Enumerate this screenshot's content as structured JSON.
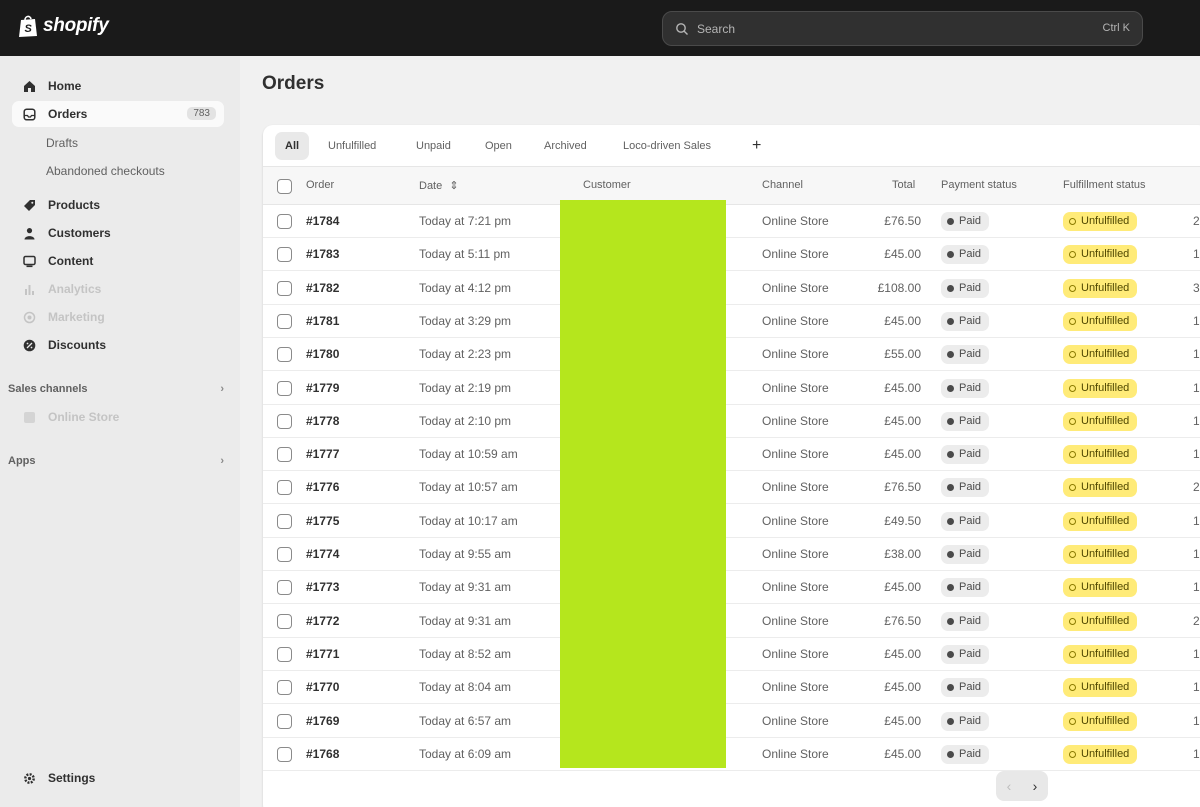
{
  "app": {
    "brand": "shopify"
  },
  "search": {
    "placeholder": "Search",
    "shortcut": "Ctrl K"
  },
  "sidebar": {
    "items": [
      {
        "label": "Home",
        "icon": "home-icon"
      },
      {
        "label": "Orders",
        "icon": "orders-icon",
        "badge": "783",
        "active": true
      },
      {
        "label": "Products",
        "icon": "tag-icon"
      },
      {
        "label": "Customers",
        "icon": "person-icon"
      },
      {
        "label": "Content",
        "icon": "content-icon"
      },
      {
        "label": "Analytics",
        "icon": "chart-icon",
        "disabled": true
      },
      {
        "label": "Marketing",
        "icon": "target-icon",
        "disabled": true
      },
      {
        "label": "Discounts",
        "icon": "discount-icon"
      }
    ],
    "order_subitems": [
      "Drafts",
      "Abandoned checkouts"
    ],
    "sales_channels": {
      "label": "Sales channels",
      "items": [
        "Online Store"
      ]
    },
    "apps": {
      "label": "Apps"
    },
    "settings": {
      "label": "Settings"
    }
  },
  "main": {
    "title": "Orders",
    "tabs": [
      "All",
      "Unfulfilled",
      "Unpaid",
      "Open",
      "Archived",
      "Loco-driven Sales"
    ],
    "add_tab": "+",
    "columns": [
      "Order",
      "Date",
      "Customer",
      "Channel",
      "Total",
      "Payment status",
      "Fulfillment status"
    ],
    "rows": [
      {
        "order": "#1784",
        "date": "Today at 7:21 pm",
        "channel": "Online Store",
        "total": "£76.50",
        "payment": "Paid",
        "fulfillment": "Unfulfilled",
        "items": "2"
      },
      {
        "order": "#1783",
        "date": "Today at 5:11 pm",
        "channel": "Online Store",
        "total": "£45.00",
        "payment": "Paid",
        "fulfillment": "Unfulfilled",
        "items": "1"
      },
      {
        "order": "#1782",
        "date": "Today at 4:12 pm",
        "channel": "Online Store",
        "total": "£108.00",
        "payment": "Paid",
        "fulfillment": "Unfulfilled",
        "items": "3"
      },
      {
        "order": "#1781",
        "date": "Today at 3:29 pm",
        "channel": "Online Store",
        "total": "£45.00",
        "payment": "Paid",
        "fulfillment": "Unfulfilled",
        "items": "1"
      },
      {
        "order": "#1780",
        "date": "Today at 2:23 pm",
        "channel": "Online Store",
        "total": "£55.00",
        "payment": "Paid",
        "fulfillment": "Unfulfilled",
        "items": "1"
      },
      {
        "order": "#1779",
        "date": "Today at 2:19 pm",
        "channel": "Online Store",
        "total": "£45.00",
        "payment": "Paid",
        "fulfillment": "Unfulfilled",
        "items": "1"
      },
      {
        "order": "#1778",
        "date": "Today at 2:10 pm",
        "channel": "Online Store",
        "total": "£45.00",
        "payment": "Paid",
        "fulfillment": "Unfulfilled",
        "items": "1"
      },
      {
        "order": "#1777",
        "date": "Today at 10:59 am",
        "channel": "Online Store",
        "total": "£45.00",
        "payment": "Paid",
        "fulfillment": "Unfulfilled",
        "items": "1"
      },
      {
        "order": "#1776",
        "date": "Today at 10:57 am",
        "channel": "Online Store",
        "total": "£76.50",
        "payment": "Paid",
        "fulfillment": "Unfulfilled",
        "items": "2"
      },
      {
        "order": "#1775",
        "date": "Today at 10:17 am",
        "channel": "Online Store",
        "total": "£49.50",
        "payment": "Paid",
        "fulfillment": "Unfulfilled",
        "items": "1"
      },
      {
        "order": "#1774",
        "date": "Today at 9:55 am",
        "channel": "Online Store",
        "total": "£38.00",
        "payment": "Paid",
        "fulfillment": "Unfulfilled",
        "items": "1"
      },
      {
        "order": "#1773",
        "date": "Today at 9:31 am",
        "channel": "Online Store",
        "total": "£45.00",
        "payment": "Paid",
        "fulfillment": "Unfulfilled",
        "items": "1"
      },
      {
        "order": "#1772",
        "date": "Today at 9:31 am",
        "channel": "Online Store",
        "total": "£76.50",
        "payment": "Paid",
        "fulfillment": "Unfulfilled",
        "items": "2"
      },
      {
        "order": "#1771",
        "date": "Today at 8:52 am",
        "channel": "Online Store",
        "total": "£45.00",
        "payment": "Paid",
        "fulfillment": "Unfulfilled",
        "items": "1"
      },
      {
        "order": "#1770",
        "date": "Today at 8:04 am",
        "channel": "Online Store",
        "total": "£45.00",
        "payment": "Paid",
        "fulfillment": "Unfulfilled",
        "items": "1"
      },
      {
        "order": "#1769",
        "date": "Today at 6:57 am",
        "channel": "Online Store",
        "total": "£45.00",
        "payment": "Paid",
        "fulfillment": "Unfulfilled",
        "items": "1"
      },
      {
        "order": "#1768",
        "date": "Today at 6:09 am",
        "channel": "Online Store",
        "total": "£45.00",
        "payment": "Paid",
        "fulfillment": "Unfulfilled",
        "items": "1"
      }
    ]
  },
  "pagination": {
    "prev": "‹",
    "next": "›"
  },
  "colors": {
    "topbar": "#1a1a1a",
    "unfulfilled_badge": "#ffeb78",
    "redaction": "#b5e61d"
  }
}
